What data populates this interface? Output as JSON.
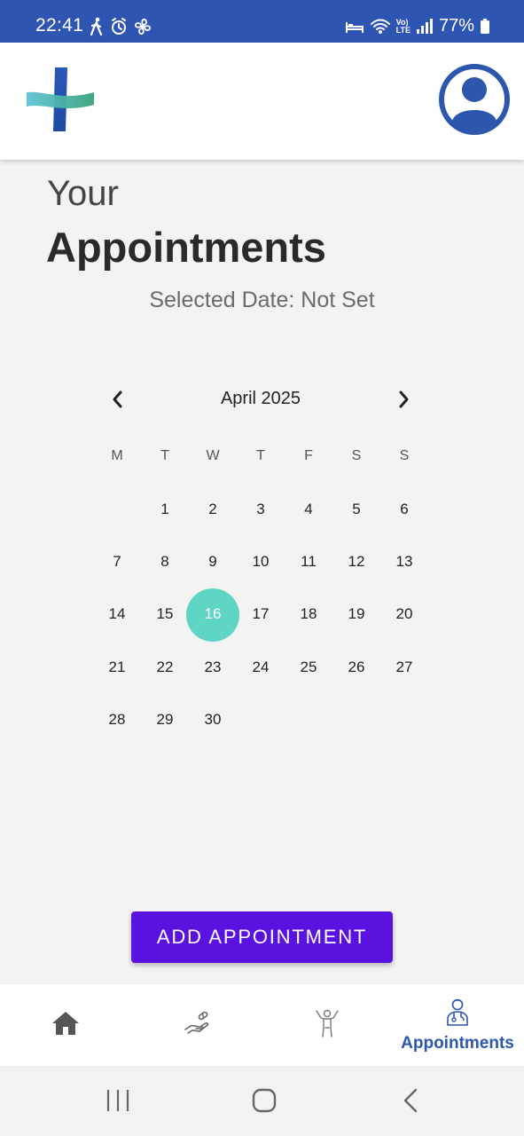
{
  "status_bar": {
    "time": "22:41",
    "battery": "77%",
    "icons": [
      "walk-icon",
      "alarm-icon",
      "fan-icon",
      "bed-icon",
      "wifi-icon",
      "volte-icon",
      "signal-icon",
      "battery-icon"
    ],
    "volte_line1": "Vo)",
    "volte_line2": "LTE"
  },
  "header": {
    "logo": "medical-cross-logo",
    "avatar": "profile-avatar-icon"
  },
  "page": {
    "heading_small": "Your",
    "heading_large": "Appointments",
    "selected_date": "Selected Date: Not Set"
  },
  "calendar": {
    "month_label": "April 2025",
    "prev_icon": "chevron-left-icon",
    "next_icon": "chevron-right-icon",
    "weekdays": [
      "M",
      "T",
      "W",
      "T",
      "F",
      "S",
      "S"
    ],
    "weeks": [
      [
        "",
        "1",
        "2",
        "3",
        "4",
        "5",
        "6"
      ],
      [
        "7",
        "8",
        "9",
        "10",
        "11",
        "12",
        "13"
      ],
      [
        "14",
        "15",
        "16",
        "17",
        "18",
        "19",
        "20"
      ],
      [
        "21",
        "22",
        "23",
        "24",
        "25",
        "26",
        "27"
      ],
      [
        "28",
        "29",
        "30",
        "",
        "",
        "",
        ""
      ]
    ],
    "selected_day": "16",
    "selected_color": "#5fd6c3"
  },
  "actions": {
    "add_label": "ADD APPOINTMENT",
    "add_color": "#5a12e0"
  },
  "bottom_nav": {
    "items": [
      {
        "icon": "home-icon",
        "label": ""
      },
      {
        "icon": "hand-pill-icon",
        "label": ""
      },
      {
        "icon": "exercise-person-icon",
        "label": ""
      },
      {
        "icon": "doctor-icon",
        "label": "Appointments"
      }
    ],
    "active_color": "#2d57ad"
  },
  "system_nav": {
    "icons": [
      "recent-apps-icon",
      "home-circle-icon",
      "back-icon"
    ]
  },
  "theme": {
    "status_bar_color": "#2f55b3",
    "background": "#f3f3f3"
  }
}
